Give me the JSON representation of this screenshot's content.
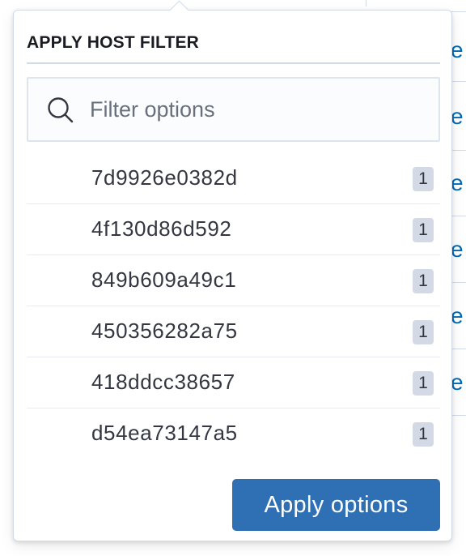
{
  "popover": {
    "title": "APPLY HOST FILTER",
    "search": {
      "placeholder": "Filter options",
      "value": ""
    },
    "options": [
      {
        "label": "7d9926e0382d",
        "count": "1"
      },
      {
        "label": "4f130d86d592",
        "count": "1"
      },
      {
        "label": "849b609a49c1",
        "count": "1"
      },
      {
        "label": "450356282a75",
        "count": "1"
      },
      {
        "label": "418ddcc38657",
        "count": "1"
      },
      {
        "label": "d54ea73147a5",
        "count": "1"
      }
    ],
    "apply_label": "Apply options"
  },
  "background": {
    "cell_fragments": [
      "e",
      "e",
      "e",
      "e",
      "e",
      "e"
    ]
  },
  "colors": {
    "accent": "#2f6fb3",
    "link": "#006bb8",
    "badge": "#d3dae6"
  },
  "icons": {
    "search": "search-icon"
  }
}
